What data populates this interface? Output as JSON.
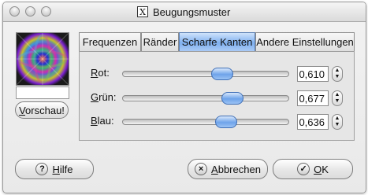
{
  "window": {
    "title": "Beugungsmuster",
    "title_icon": "x11-icon"
  },
  "preview": {
    "button_prefix": "",
    "button_mnemonic": "V",
    "button_rest": "orschau!"
  },
  "tabs": [
    {
      "label": "Frequenzen",
      "active": false
    },
    {
      "label": "Ränder",
      "active": false
    },
    {
      "label": "Scharfe Kanten",
      "active": true
    },
    {
      "label": "Andere Einstellungen",
      "active": false
    }
  ],
  "rows": [
    {
      "mnemonic": "R",
      "label_rest": "ot:",
      "value": "0,610",
      "fraction": 0.61
    },
    {
      "mnemonic": "G",
      "label_rest": "rün:",
      "value": "0,677",
      "fraction": 0.677
    },
    {
      "mnemonic": "B",
      "label_rest": "lau:",
      "value": "0,636",
      "fraction": 0.636
    }
  ],
  "buttons": {
    "help": {
      "mnemonic": "H",
      "rest": "ilfe",
      "icon": "?"
    },
    "cancel": {
      "mnemonic": "A",
      "rest": "bbrechen",
      "icon": "×"
    },
    "ok": {
      "mnemonic": "O",
      "rest": "K",
      "icon": "✓"
    }
  }
}
